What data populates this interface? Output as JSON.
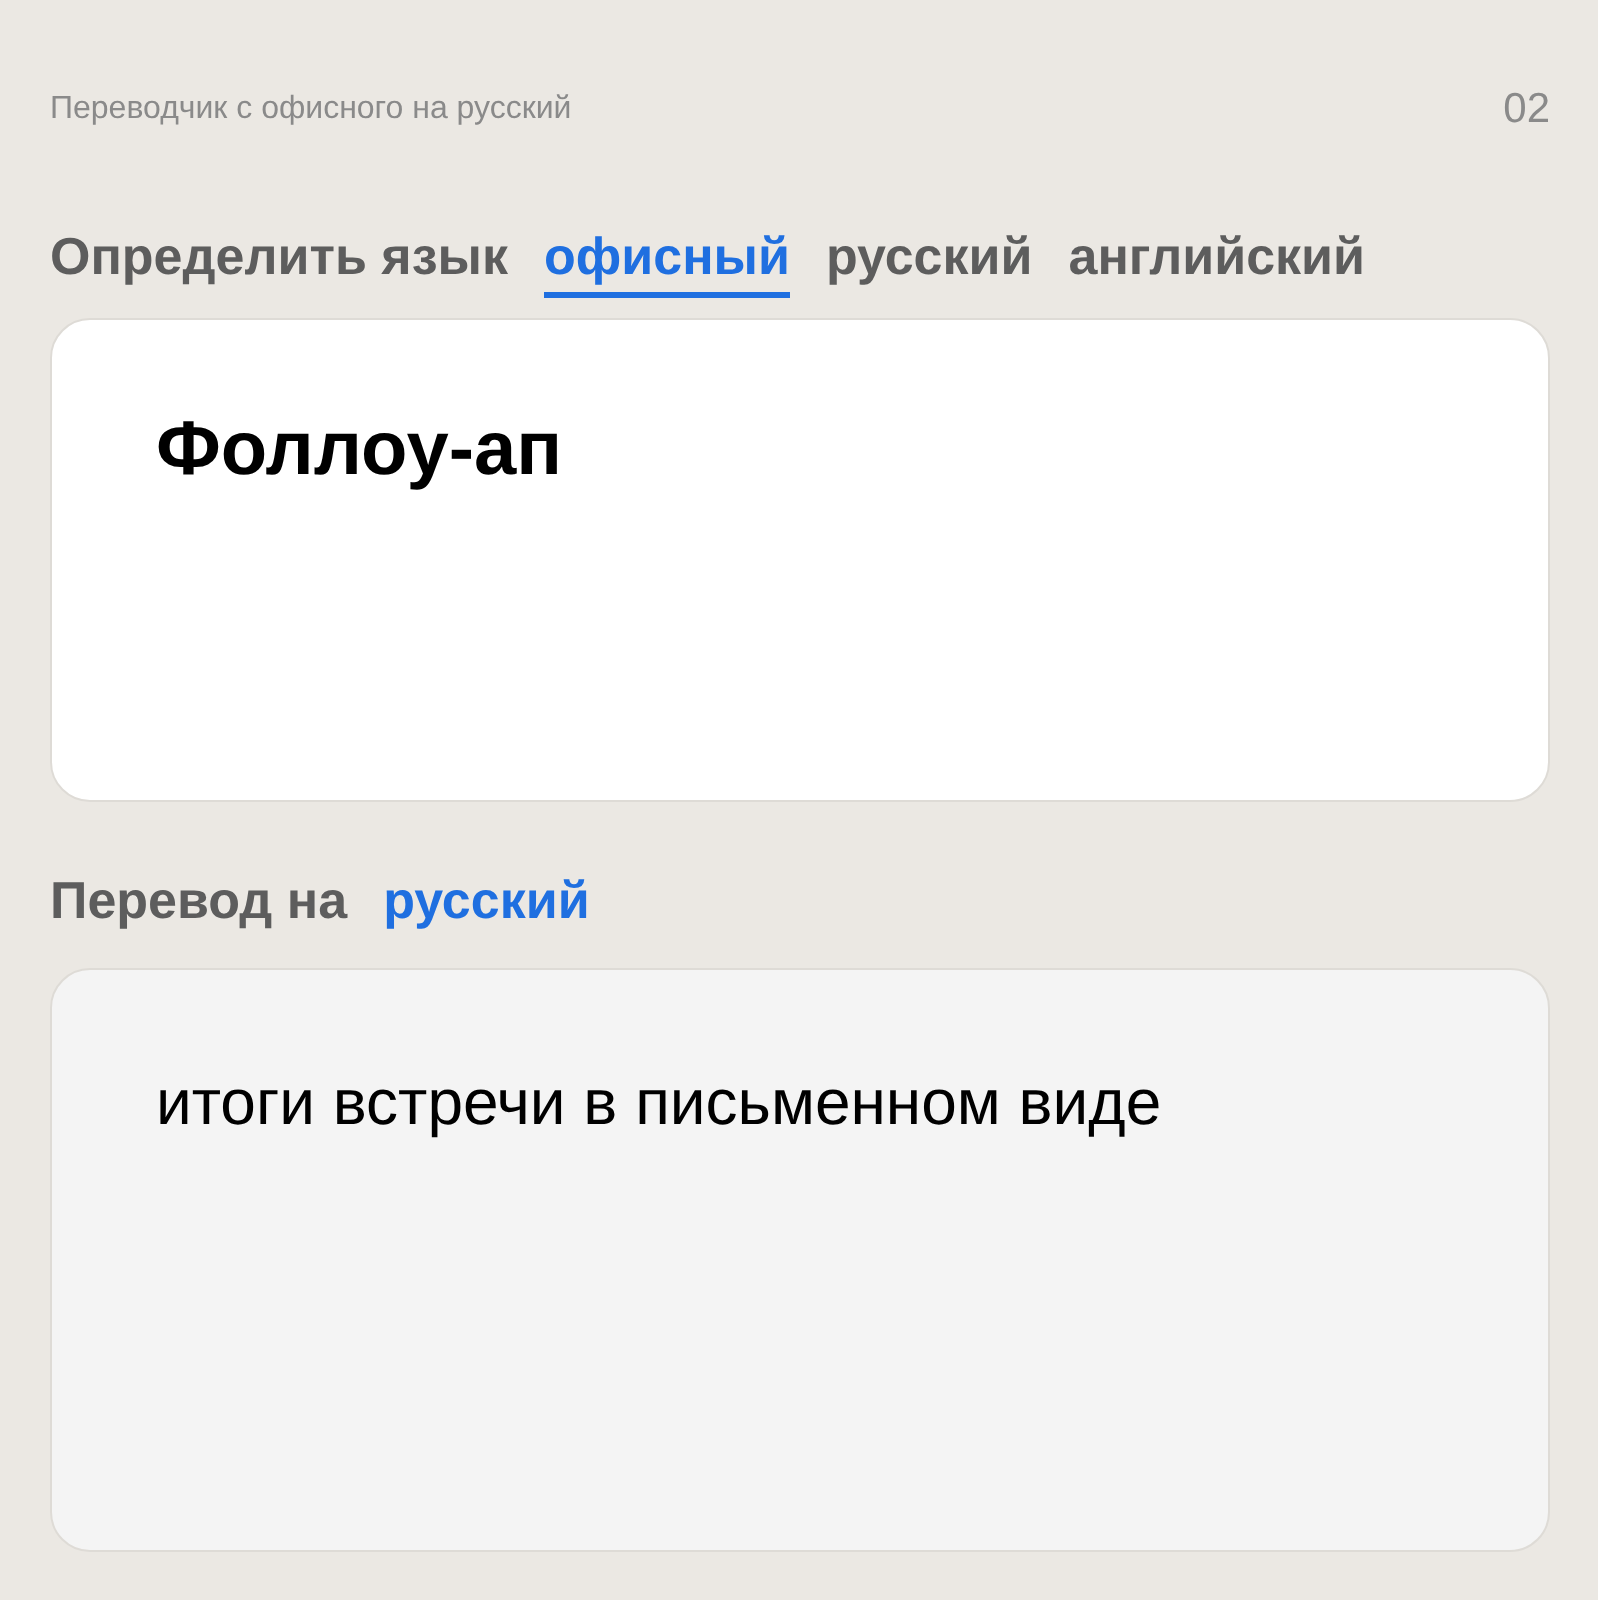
{
  "header": {
    "title": "Переводчик с офисного на русский",
    "page": "02"
  },
  "source_languages": [
    {
      "label": "Определить язык",
      "selected": false
    },
    {
      "label": "офисный",
      "selected": true
    },
    {
      "label": "русский",
      "selected": false
    },
    {
      "label": "английский",
      "selected": false
    }
  ],
  "input": {
    "value": "Фоллоу-ап"
  },
  "target": {
    "label": "Перевод на",
    "language": "русский"
  },
  "output": {
    "text": "итоги встречи в письменном виде"
  }
}
